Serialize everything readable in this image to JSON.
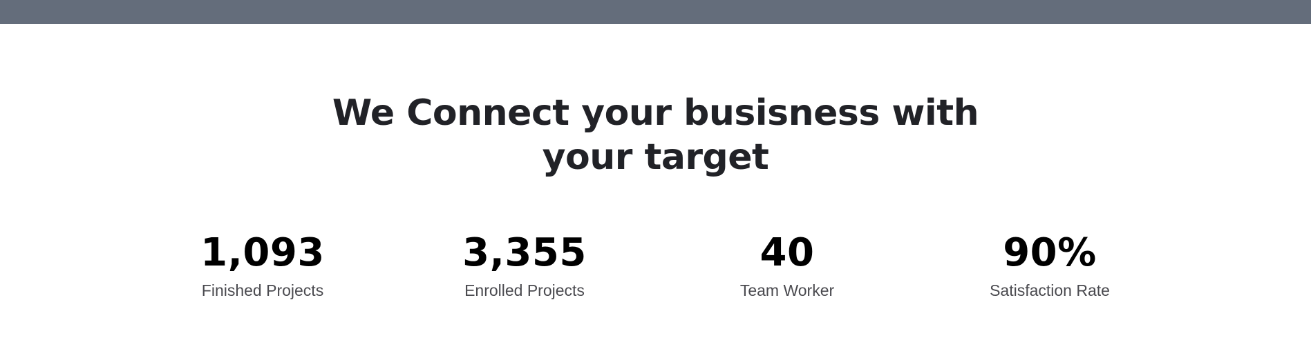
{
  "hero": {
    "headline_line1": "We Connect your busisness with",
    "headline_line2": "your target"
  },
  "stats": [
    {
      "value": "1,093",
      "label": "Finished Projects"
    },
    {
      "value": "3,355",
      "label": "Enrolled Projects"
    },
    {
      "value": "40",
      "label": "Team Worker"
    },
    {
      "value": "90%",
      "label": "Satisfaction Rate"
    }
  ],
  "colors": {
    "top_bar": "#646d7b",
    "headline": "#212227",
    "stat_value": "#000000",
    "stat_label": "#4a4a4f"
  }
}
